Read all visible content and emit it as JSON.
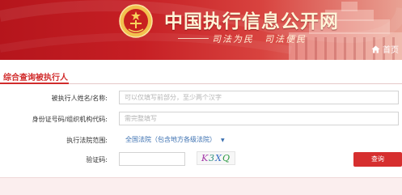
{
  "site": {
    "title": "中国执行信息公开网",
    "motto": "司法为民　司法便民",
    "home_label": "首页"
  },
  "panel": {
    "title": "综合查询被执行人"
  },
  "form": {
    "name_label": "被执行人姓名/名称:",
    "name_placeholder": "可以仅填写前部分，至少两个汉字",
    "id_label": "身份证号码/组织机构代码:",
    "id_placeholder": "需完整填写",
    "court_label": "执行法院范围:",
    "court_value": "全国法院（包含地方各级法院）",
    "captcha_label": "验证码:",
    "captcha_text": [
      "K",
      "3",
      "X",
      "Q"
    ],
    "search_label": "查询"
  },
  "colors": {
    "brand_red": "#c61f24",
    "accent_red": "#d62f2f",
    "link_blue": "#3a6fb0"
  }
}
